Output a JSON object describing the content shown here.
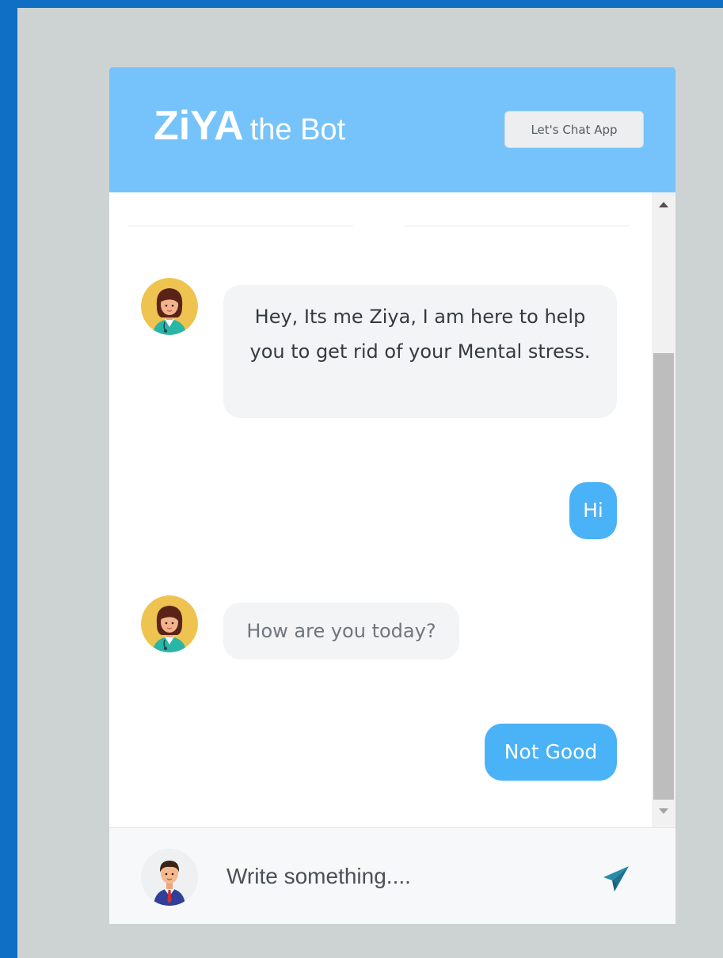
{
  "header": {
    "brand_main": "ZiYA",
    "brand_sub": "the Bot",
    "app_badge": "Let's Chat App"
  },
  "messages": [
    {
      "sender": "bot",
      "text": "Hey, Its me Ziya, I am here to help you to get rid of your Mental stress."
    },
    {
      "sender": "user",
      "text": "Hi"
    },
    {
      "sender": "bot",
      "text": "How are you today?"
    },
    {
      "sender": "user",
      "text": "Not Good"
    }
  ],
  "composer": {
    "placeholder": "Write something....",
    "send_icon": "paper-plane-icon"
  },
  "colors": {
    "page_border": "#0f6fc4",
    "page_background": "#ccd3d2",
    "header": "#76c3fb",
    "user_bubble": "#4ab2f6",
    "bot_bubble": "#f3f4f6",
    "send_icon": "#2a8ca8"
  }
}
